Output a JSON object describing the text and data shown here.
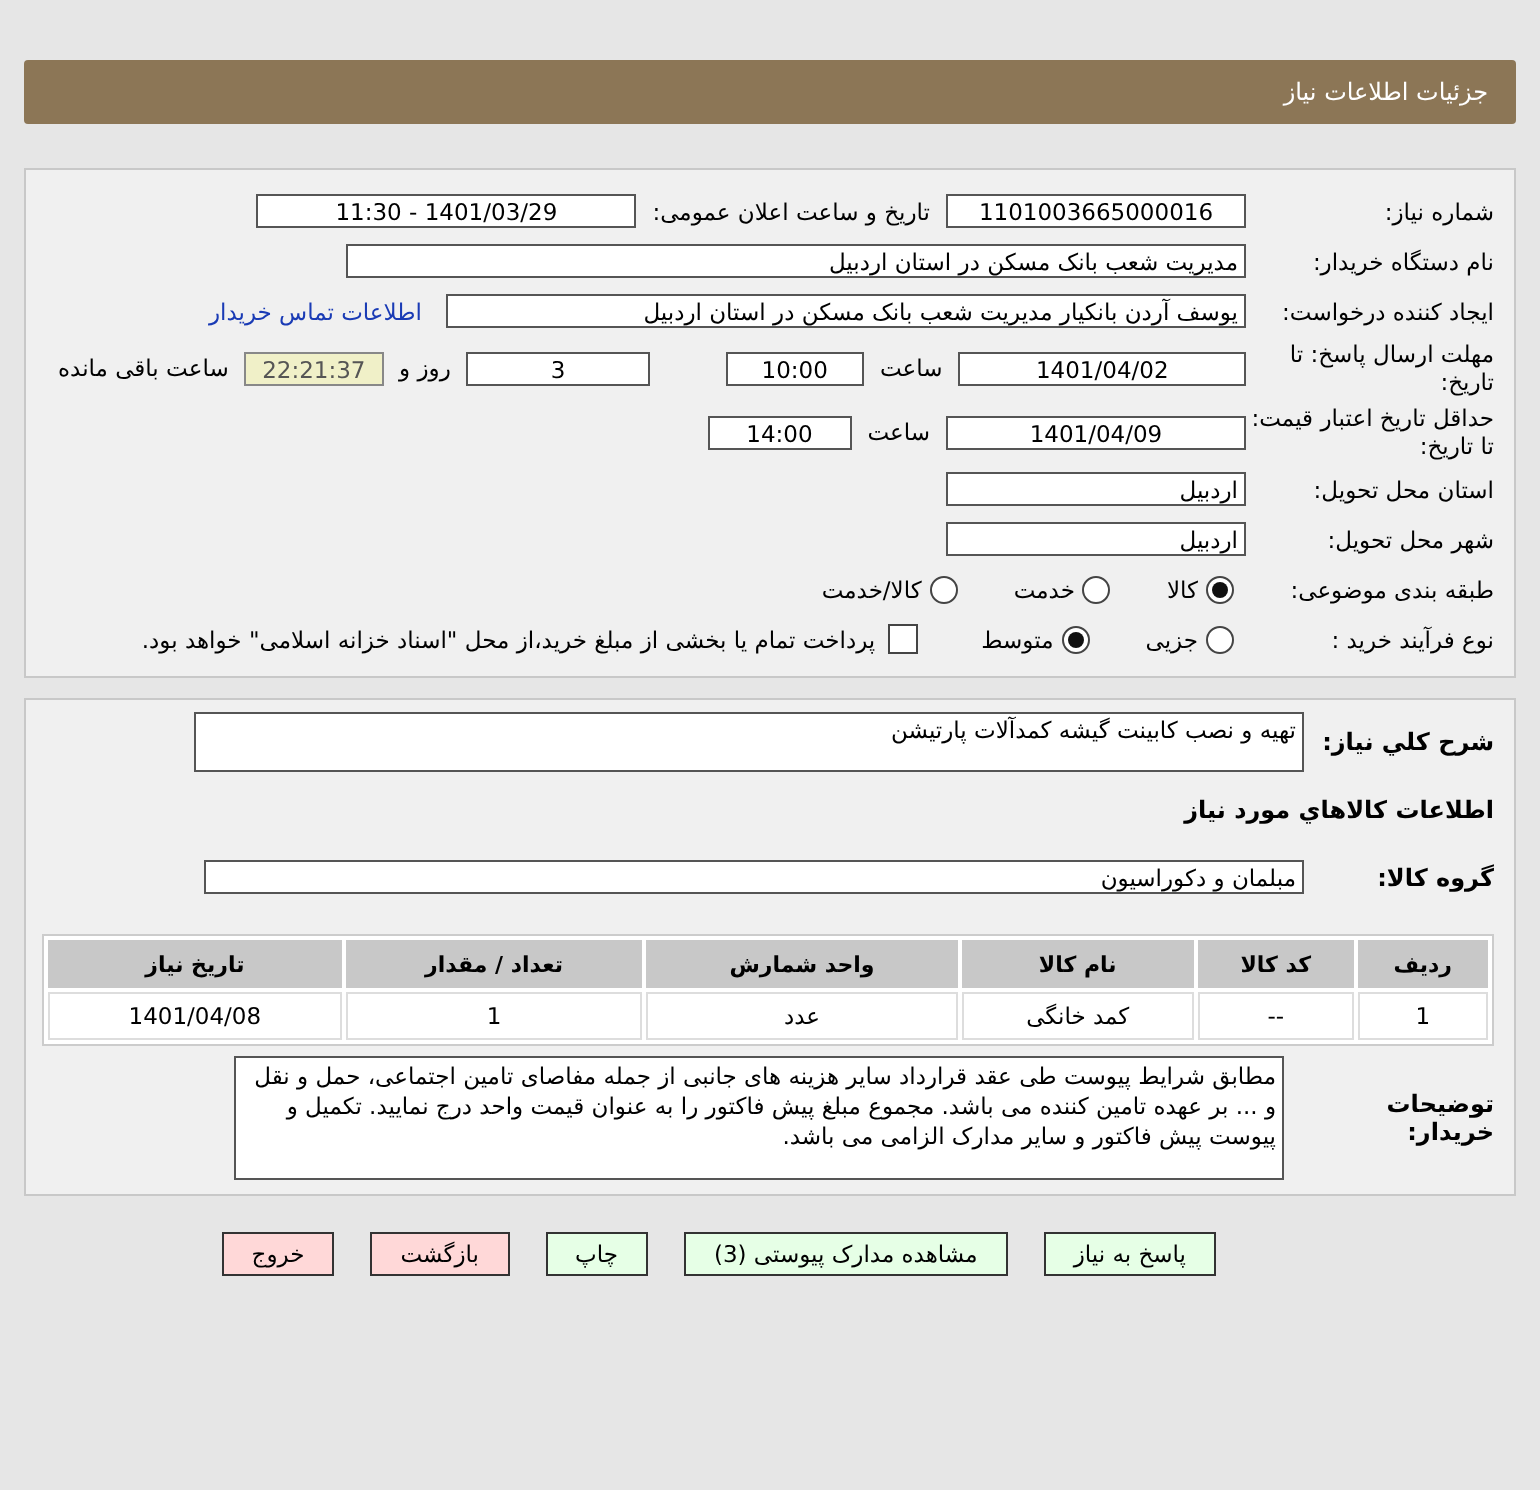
{
  "header": {
    "title": "جزئیات اطلاعات نیاز"
  },
  "details": {
    "need_number": {
      "label": "شماره نیاز:",
      "value": "1101003665000016"
    },
    "announce": {
      "label": "تاریخ و ساعت اعلان عمومی:",
      "value": "1401/03/29 - 11:30"
    },
    "buyer_org": {
      "label": "نام دستگاه خریدار:",
      "value": "مدیریت شعب بانک مسکن در استان اردبیل"
    },
    "creator": {
      "label": "ایجاد کننده درخواست:",
      "value": "یوسف  آردن بانکیار مدیریت شعب بانک مسکن در استان اردبیل",
      "link": "اطلاعات تماس خریدار"
    },
    "deadline": {
      "label": "مهلت ارسال پاسخ: تا تاریخ:",
      "date": "1401/04/02",
      "time_label": "ساعت",
      "time": "10:00",
      "days": "3",
      "days_label": "روز و",
      "remaining": "22:21:37",
      "remaining_label": "ساعت باقی مانده"
    },
    "validity": {
      "label": "حداقل تاریخ اعتبار قیمت: تا تاریخ:",
      "date": "1401/04/09",
      "time_label": "ساعت",
      "time": "14:00"
    },
    "province": {
      "label": "استان محل تحویل:",
      "value": "اردبیل"
    },
    "city": {
      "label": "شهر محل تحویل:",
      "value": "اردبیل"
    },
    "category": {
      "label": "طبقه بندی موضوعی:",
      "options": [
        {
          "label": "کالا",
          "selected": true
        },
        {
          "label": "خدمت",
          "selected": false
        },
        {
          "label": "کالا/خدمت",
          "selected": false
        }
      ]
    },
    "process": {
      "label": "نوع فرآیند خرید :",
      "options": [
        {
          "label": "جزیی",
          "selected": false
        },
        {
          "label": "متوسط",
          "selected": true
        }
      ],
      "payment": {
        "label": "پرداخت تمام یا بخشی از مبلغ خرید،از محل \"اسناد خزانه اسلامی\" خواهد بود.",
        "checked": false
      }
    }
  },
  "summary": {
    "label": "شرح کلي نیاز:",
    "value": "تهیه و نصب کابینت گیشه کمدآلات پارتیشن"
  },
  "goods_title": "اطلاعات کالاهاي مورد نیاز",
  "goods_group": {
    "label": "گروه کالا:",
    "value": "مبلمان و دکوراسیون"
  },
  "table": {
    "columns": [
      "ردیف",
      "کد کالا",
      "نام کالا",
      "واحد شمارش",
      "تعداد / مقدار",
      "تاریخ نیاز"
    ],
    "rows": [
      [
        "1",
        "--",
        "کمد خانگی",
        "عدد",
        "1",
        "1401/04/08"
      ]
    ]
  },
  "buyer_notes": {
    "label": "توضیحات خریدار:",
    "value": "مطابق شرایط پیوست طی عقد قرارداد سایر هزینه های جانبی از جمله مفاصای تامین اجتماعی، حمل و نقل و ... بر عهده تامین کننده می باشد. مجموع مبلغ پیش فاکتور را به عنوان قیمت واحد درج نمایید. تکمیل و پیوست پیش فاکتور و سایر مدارک الزامی می باشد."
  },
  "buttons": [
    {
      "label": "پاسخ به نیاز",
      "kind": "action"
    },
    {
      "label": "مشاهده مدارک پیوستی (3)",
      "kind": "action"
    },
    {
      "label": "چاپ",
      "kind": "action"
    },
    {
      "label": "بازگشت",
      "kind": "exit"
    },
    {
      "label": "خروج",
      "kind": "exit"
    }
  ]
}
